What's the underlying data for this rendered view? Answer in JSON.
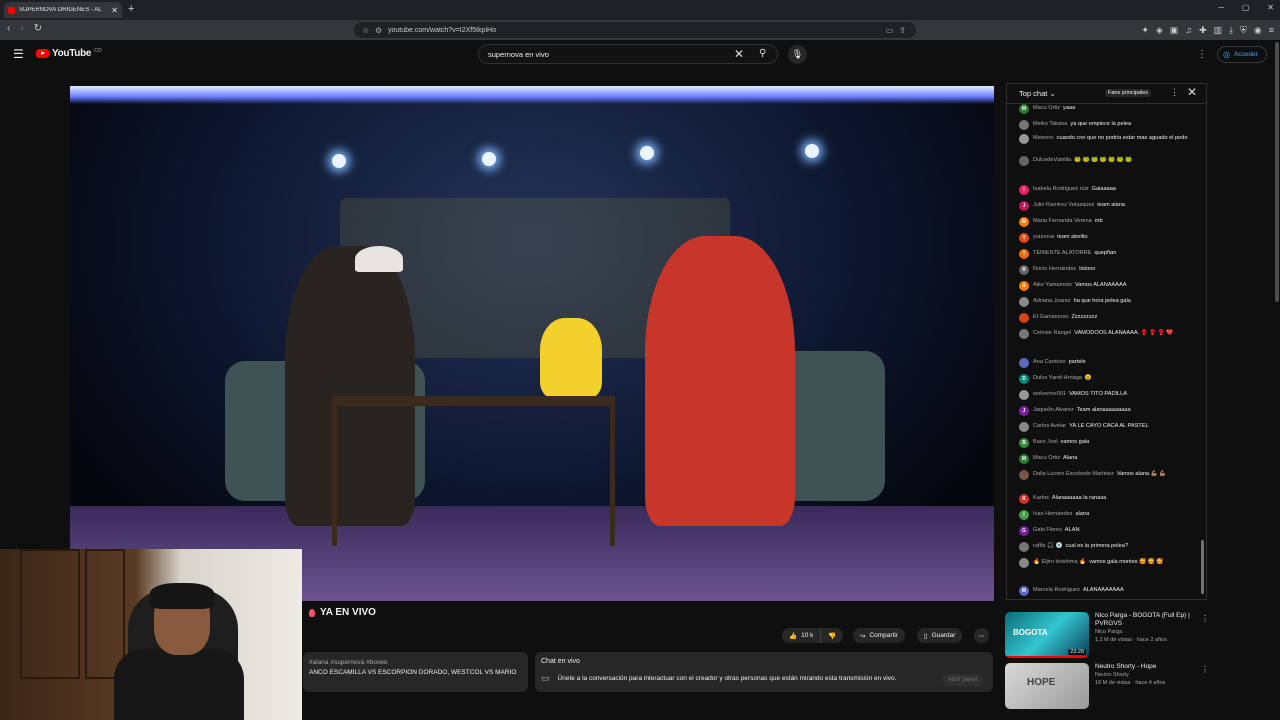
{
  "browser": {
    "tab_title": "SUPERNOVA ORIGENES - AL",
    "tab_close": "✕",
    "new_tab": "+",
    "url": "youtube.com/watch?v=I2Xf5tkpiHo",
    "window_controls": [
      "─",
      "▢",
      "✕"
    ]
  },
  "youtube": {
    "logo_text": "YouTube",
    "country": "CO",
    "search_value": "supernova en vivo",
    "signin_label": "Acceder"
  },
  "video": {
    "title": "YA EN VIVO",
    "like_count": "10 k",
    "share_label": "Compartir",
    "save_label": "Guardar",
    "description_tags": "#alana #supernova #boxeo",
    "description_text": "ANCO ESCAMILLA VS ESCORPION DORADO, WESTCOL VS MARIO"
  },
  "live_chat_box": {
    "heading": "Chat en vivo",
    "message": "Únete a la conversación para interactuar con el creador y otras personas que están mirando esta transmisión en vivo.",
    "button": "Abrir panel"
  },
  "chat": {
    "mode": "Top chat",
    "fans_label": "Fans principales",
    "messages": [
      {
        "author": "Macu Ortiz",
        "text": "yaaa",
        "initial": "M",
        "color": "#2e7d32"
      },
      {
        "author": "Meiko Takana",
        "text": "ya que empiece la pelea",
        "initial": "",
        "color": "#777"
      },
      {
        "author": "Meteoro",
        "text": "cuando crei que no podria estar mas aguado el pedo",
        "initial": "",
        "color": "#999"
      },
      {
        "author": "DulcedeVainilla",
        "text": "🐸 🐸 🐸 🐸 🐸 🐸 🐸",
        "initial": "",
        "color": "#666"
      },
      {
        "author": "Isabela Rodriguez ruiz",
        "text": "Galaaaaa",
        "initial": "I",
        "color": "#e91e63"
      },
      {
        "author": "Julio Ramirez Velazquez",
        "text": "team alana",
        "initial": "J",
        "color": "#c2185b"
      },
      {
        "author": "Maria Fernanda Verena",
        "text": "mb",
        "initial": "M",
        "color": "#f57c00"
      },
      {
        "author": "yuunova",
        "text": "team abelito",
        "initial": "Y",
        "color": "#e64a19"
      },
      {
        "author": "TENIENTE ALATORRE",
        "text": "quepñan",
        "initial": "T",
        "color": "#ef6c00"
      },
      {
        "author": "Rocio Hernández",
        "text": "listooo",
        "initial": "R",
        "color": "#616161"
      },
      {
        "author": "Aiko Yamamoto",
        "text": "Vamos ALANAAAAA",
        "initial": "A",
        "color": "#f57c00"
      },
      {
        "author": "Adriana Juarez",
        "text": "ha que hora pelea gala",
        "initial": "",
        "color": "#888"
      },
      {
        "author": "El Gamaverso",
        "text": "Zzzzzzzzz",
        "initial": "",
        "color": "#d84315"
      },
      {
        "author": "Celeste Rangel",
        "text": "VAMODOOS ALANAAAA. 🥊 🥊 🥊 ❤️",
        "initial": "",
        "color": "#777"
      },
      {
        "author": "Ana Cardoso",
        "text": "partele",
        "initial": "",
        "color": "#5c6bc0"
      },
      {
        "author": "Dulce Yareli Arriaga",
        "text": "😮",
        "initial": "D",
        "color": "#00897b"
      },
      {
        "author": "wolverine001",
        "text": "VAMOS TITO PADILLA",
        "initial": "",
        "color": "#999"
      },
      {
        "author": "Jaquelin Alvarez",
        "text": "Team alanaaaaaaaaa",
        "initial": "J",
        "color": "#7b1fa2"
      },
      {
        "author": "Carlos Avelar",
        "text": "YA LE CAYO CACA AL PASTEL",
        "initial": "",
        "color": "#888"
      },
      {
        "author": "Baez Joel",
        "text": "vamos gala",
        "initial": "B",
        "color": "#388e3c"
      },
      {
        "author": "Macu Ortiz",
        "text": "Alana",
        "initial": "M",
        "color": "#2e7d32"
      },
      {
        "author": "Dalia Lucero Escobedo Martinez",
        "text": "Vamos alana 💪🏽 💪🏽",
        "initial": "",
        "color": "#795548"
      },
      {
        "author": "Karlos",
        "text": "Alanaaaaaa la ranasa",
        "initial": "K",
        "color": "#d32f2f"
      },
      {
        "author": "Ivan Hernández",
        "text": "alana",
        "initial": "I",
        "color": "#43a047"
      },
      {
        "author": "Gabi Flores",
        "text": "ALAN",
        "initial": "G",
        "color": "#7b1fa2"
      },
      {
        "author": "rafifa 🎧 💿",
        "text": "cual es la primera pelea?",
        "initial": "",
        "color": "#777"
      },
      {
        "author": "🔥 Eljiro kirishima 🔥",
        "text": "vamos gala montes 🥰 🥰 🥰",
        "initial": "",
        "color": "#888"
      },
      {
        "author": "Marcela Rodriguez",
        "text": "ALANAAAAAAA",
        "initial": "M",
        "color": "#5c6bc0"
      }
    ]
  },
  "recommendations": [
    {
      "title": "Nico Parga - BOGOTA (Full Ep) | PVRGVS",
      "channel": "Nico Parga",
      "meta": "1,2 M de vistas · hace 2 años",
      "duration": "23:28",
      "thumb_text": "BOGOTA"
    },
    {
      "title": "Neutro Shorty - Hope",
      "channel": "Neutro Shorty",
      "meta": "19 M de vistas · hace 4 años",
      "duration": "",
      "thumb_text": "HOPE"
    }
  ]
}
